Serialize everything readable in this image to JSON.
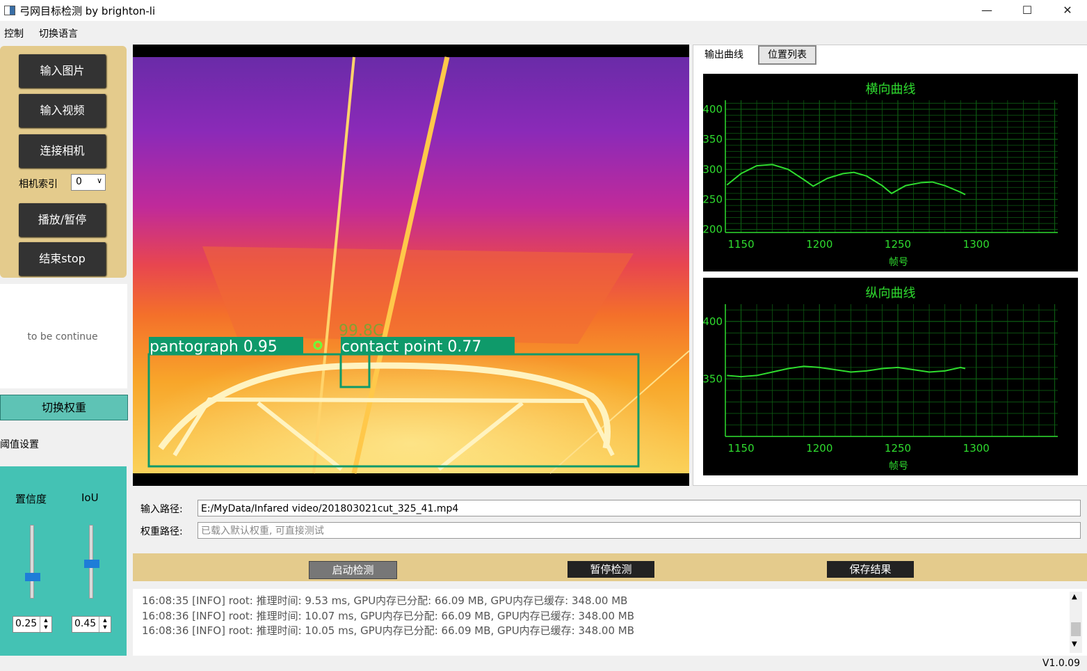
{
  "window": {
    "title": "弓网目标检测 by brighton-li",
    "minimize": "—",
    "maximize": "☐",
    "close": "✕"
  },
  "menu": [
    "控制",
    "切换语言"
  ],
  "left_panel": {
    "buttons": [
      "输入图片",
      "输入视频",
      "连接相机",
      "播放/暂停",
      "结束stop"
    ],
    "camera_index_label": "相机索引",
    "camera_index_value": "0",
    "continue_text": "to be continue",
    "switch_weights": "切换权重",
    "threshold_label": "阈值设置",
    "confidence_label": "置信度",
    "iou_label": "IoU",
    "confidence_value": "0.25",
    "iou_value": "0.45"
  },
  "video": {
    "detections": [
      {
        "label": "pantograph 0.95"
      },
      {
        "label": "contact point 0.77"
      }
    ],
    "faint_text": "99.8C"
  },
  "tabs": [
    "输出曲线",
    "位置列表"
  ],
  "chart_data": [
    {
      "type": "line",
      "title": "横向曲线",
      "xlabel": "帧号",
      "xlim": [
        1140,
        1352
      ],
      "ylim": [
        195,
        415
      ],
      "xticks": [
        "1150",
        "1200",
        "1250",
        "1300"
      ],
      "yticks": [
        "400",
        "350",
        "300",
        "250",
        "200"
      ],
      "x": [
        1141,
        1150,
        1160,
        1170,
        1180,
        1190,
        1196,
        1205,
        1215,
        1222,
        1230,
        1240,
        1246,
        1255,
        1265,
        1272,
        1280,
        1290,
        1293
      ],
      "y": [
        274,
        293,
        306,
        308,
        300,
        283,
        272,
        285,
        293,
        295,
        289,
        273,
        260,
        273,
        278,
        279,
        273,
        262,
        258
      ],
      "grid": true
    },
    {
      "type": "line",
      "title": "纵向曲线",
      "xlabel": "帧号",
      "xlim": [
        1140,
        1352
      ],
      "ylim": [
        300,
        415
      ],
      "xticks": [
        "1150",
        "1200",
        "1250",
        "1300"
      ],
      "yticks": [
        "400",
        "350"
      ],
      "x": [
        1141,
        1150,
        1160,
        1170,
        1180,
        1190,
        1200,
        1210,
        1220,
        1230,
        1240,
        1250,
        1260,
        1270,
        1280,
        1290,
        1293
      ],
      "y": [
        353,
        352,
        353,
        356,
        359,
        361,
        360,
        358,
        356,
        357,
        359,
        360,
        358,
        356,
        357,
        360,
        359
      ],
      "grid": true
    }
  ],
  "paths": {
    "input_label": "输入路径:",
    "input_value": "E:/MyData/Infared video/201803021cut_325_41.mp4",
    "weights_label": "权重路径:",
    "weights_placeholder": "已载入默认权重, 可直接测试"
  },
  "actions": [
    "启动检测",
    "暂停检测",
    "保存结果"
  ],
  "log": [
    "16:08:35 [INFO] root: 推理时间: 9.53 ms, GPU内存已分配: 66.09 MB, GPU内存已缓存: 348.00 MB",
    "16:08:36 [INFO] root: 推理时间: 10.07 ms, GPU内存已分配: 66.09 MB, GPU内存已缓存: 348.00 MB",
    "16:08:36 [INFO] root: 推理时间: 10.05 ms, GPU内存已分配: 66.09 MB, GPU内存已缓存: 348.00 MB"
  ],
  "version": "V1.0.09",
  "colors": {
    "panel_tan": "#e4cb8c",
    "panel_teal": "#44c2b4",
    "chart_green": "#2fdc2f",
    "bbox": "#0f9a6a"
  }
}
